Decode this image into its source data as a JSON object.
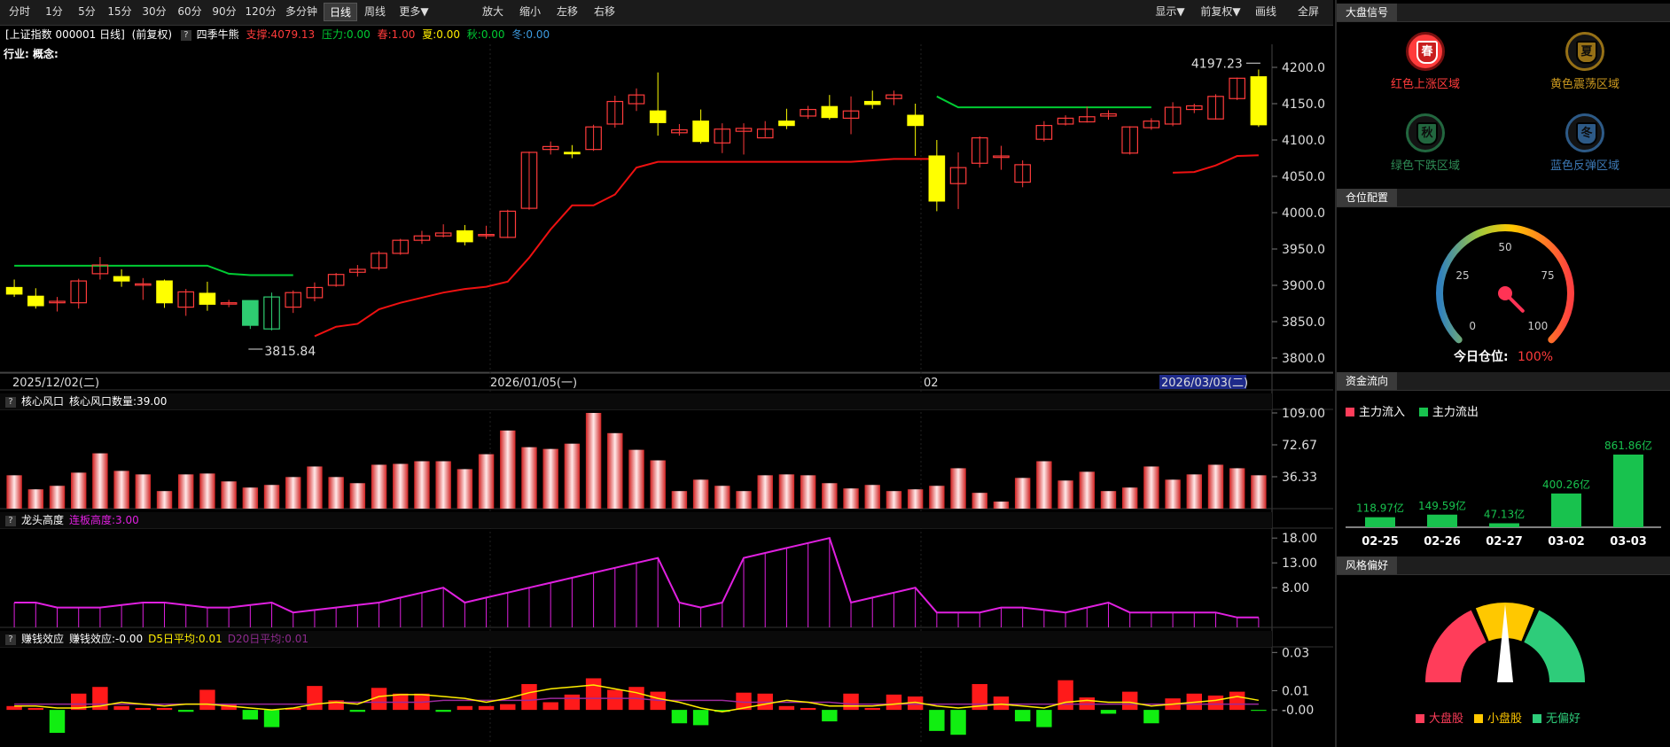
{
  "toolbar": {
    "periods": [
      "分时",
      "1分",
      "5分",
      "15分",
      "30分",
      "60分",
      "90分",
      "120分",
      "多分钟",
      "日线",
      "周线",
      "更多▼"
    ],
    "active": "日线",
    "zoom_in": "放大",
    "zoom_out": "缩小",
    "move_left": "左移",
    "move_right": "右移",
    "display": "显示▼",
    "adjust": "前复权▼",
    "draw": "画线",
    "fullscreen": "全屏"
  },
  "info": {
    "security": "[上证指数 000001 日线]",
    "adjust": "(前复权)",
    "indicator": "四季牛熊",
    "support": "支撑:4079.13",
    "pressure": "压力:0.00",
    "spring": "春:1.00",
    "summer": "夏:0.00",
    "autumn": "秋:0.00",
    "winter": "冬:0.00"
  },
  "industry": "行业: 概念:",
  "colors": {
    "up": "#ff3b3b",
    "down_fill": "#ffff00",
    "green": "#00cc33",
    "line_red": "#ee1111",
    "magenta": "#e020e0",
    "yellow": "#ffee00"
  },
  "price_axis": {
    "min": 3800,
    "max": 4200,
    "ticks": [
      "4200.0",
      "4150.0",
      "4100.0",
      "4050.0",
      "4000.0",
      "3950.0",
      "3900.0",
      "3850.0",
      "3800.0"
    ]
  },
  "date_axis": {
    "labels": [
      "2025/12/02(二)",
      "2026/01/05(一)",
      "02",
      "2026/03/03(二)"
    ]
  },
  "annotations": {
    "high": "4197.23",
    "low": "3815.84"
  },
  "candles": [
    [
      3897,
      3888,
      3908,
      3884
    ],
    [
      3885,
      3872,
      3896,
      3868
    ],
    [
      3876,
      3878,
      3884,
      3864
    ],
    [
      3876,
      3906,
      3909,
      3868
    ],
    [
      3916,
      3928,
      3939,
      3908
    ],
    [
      3912,
      3906,
      3922,
      3898
    ],
    [
      3902,
      3902,
      3910,
      3880
    ],
    [
      3906,
      3876,
      3908,
      3869
    ],
    [
      3870,
      3891,
      3895,
      3858
    ],
    [
      3889,
      3874,
      3905,
      3865
    ],
    [
      3876,
      3876,
      3880,
      3870
    ],
    [
      3879,
      3845,
      3879,
      3840
    ],
    [
      3840,
      3884,
      3890,
      3838
    ],
    [
      3870,
      3890,
      3893,
      3862
    ],
    [
      3883,
      3897,
      3904,
      3878
    ],
    [
      3900,
      3915,
      3917,
      3898
    ],
    [
      3918,
      3922,
      3928,
      3912
    ],
    [
      3924,
      3944,
      3947,
      3921
    ],
    [
      3944,
      3962,
      3964,
      3942
    ],
    [
      3962,
      3968,
      3975,
      3957
    ],
    [
      3968,
      3972,
      3984,
      3966
    ],
    [
      3975,
      3960,
      3983,
      3955
    ],
    [
      3970,
      3970,
      3982,
      3964
    ],
    [
      3966,
      4002,
      4004,
      3965
    ],
    [
      4006,
      4083,
      4084,
      4004
    ],
    [
      4087,
      4091,
      4098,
      4080
    ],
    [
      4083,
      4081,
      4093,
      4075
    ],
    [
      4087,
      4118,
      4121,
      4085
    ],
    [
      4122,
      4153,
      4161,
      4117
    ],
    [
      4150,
      4162,
      4171,
      4140
    ],
    [
      4140,
      4124,
      4193,
      4106
    ],
    [
      4110,
      4114,
      4122,
      4106
    ],
    [
      4126,
      4098,
      4142,
      4095
    ],
    [
      4096,
      4115,
      4123,
      4082
    ],
    [
      4112,
      4116,
      4123,
      4080
    ],
    [
      4103,
      4115,
      4126,
      4104
    ],
    [
      4126,
      4120,
      4143,
      4115
    ],
    [
      4133,
      4142,
      4147,
      4129
    ],
    [
      4146,
      4131,
      4162,
      4128
    ],
    [
      4130,
      4140,
      4160,
      4108
    ],
    [
      4153,
      4149,
      4168,
      4143
    ],
    [
      4157,
      4162,
      4168,
      4148
    ],
    [
      4134,
      4120,
      4150,
      4078
    ],
    [
      4078,
      4016,
      4100,
      4002
    ],
    [
      4040,
      4062,
      4083,
      4005
    ],
    [
      4068,
      4103,
      4105,
      4062
    ],
    [
      4076,
      4078,
      4092,
      4059
    ],
    [
      4042,
      4066,
      4072,
      4035
    ],
    [
      4101,
      4120,
      4126,
      4098
    ],
    [
      4122,
      4130,
      4134,
      4120
    ],
    [
      4125,
      4132,
      4146,
      4124
    ],
    [
      4133,
      4136,
      4141,
      4128
    ],
    [
      4082,
      4118,
      4119,
      4080
    ],
    [
      4117,
      4126,
      4130,
      4114
    ],
    [
      4122,
      4145,
      4152,
      4119
    ],
    [
      4142,
      4147,
      4150,
      4137
    ],
    [
      4129,
      4160,
      4163,
      4128
    ],
    [
      4157,
      4185,
      4186,
      4155
    ],
    [
      4187,
      4121,
      4197,
      4118
    ]
  ],
  "support_line": [
    null,
    null,
    null,
    null,
    null,
    null,
    null,
    null,
    null,
    null,
    null,
    null,
    null,
    null,
    3830,
    3843,
    3847,
    3867,
    3876,
    3883,
    3890,
    3895,
    3898,
    3905,
    3938,
    3977,
    4010,
    4010,
    4025,
    4062,
    4070,
    4070,
    4070,
    4070,
    4070,
    4070,
    4070,
    4070,
    4070,
    4070,
    4072,
    4074,
    4074,
    4074,
    null,
    null,
    null,
    null,
    null,
    null,
    null,
    null,
    null,
    null,
    4055,
    4056,
    4065,
    4078,
    4079
  ],
  "pressure_line": [
    3927,
    3927,
    3927,
    3927,
    3927,
    3927,
    3927,
    3927,
    3927,
    3927,
    3916,
    3914,
    3914,
    3914,
    null,
    null,
    null,
    null,
    null,
    null,
    null,
    null,
    null,
    null,
    null,
    null,
    null,
    null,
    null,
    null,
    null,
    null,
    null,
    null,
    null,
    null,
    null,
    null,
    null,
    null,
    null,
    null,
    null,
    4160,
    4145,
    4145,
    4145,
    4145,
    4145,
    4145,
    4145,
    4145,
    4145,
    4145,
    null,
    null,
    null,
    null,
    null
  ],
  "panel1": {
    "title": "核心风口",
    "value_label": "核心风口数量:39.00",
    "ticks": [
      "109.00",
      "72.67",
      "36.33"
    ],
    "max": 109,
    "values": [
      38,
      22,
      26,
      41,
      63,
      43,
      39,
      20,
      39,
      40,
      31,
      24,
      27,
      36,
      48,
      36,
      29,
      50,
      51,
      54,
      54,
      45,
      62,
      89,
      70,
      68,
      74,
      109,
      86,
      67,
      55,
      20,
      33,
      26,
      20,
      38,
      39,
      38,
      29,
      23,
      27,
      20,
      22,
      26,
      46,
      18,
      8,
      35,
      54,
      32,
      42,
      20,
      24,
      48,
      33,
      39,
      50,
      46,
      38
    ]
  },
  "panel2": {
    "title": "龙头高度",
    "value_label": "连板高度:3.00",
    "ticks": [
      "18.00",
      "13.00",
      "8.00"
    ],
    "max": 20,
    "values": [
      5,
      5,
      4,
      4,
      4,
      4.5,
      5,
      5,
      4.5,
      4,
      4,
      4.5,
      5,
      3,
      3.5,
      4,
      4.5,
      5,
      6,
      7,
      8,
      5,
      6,
      7,
      8,
      9,
      10,
      11,
      12,
      13,
      14,
      5,
      4,
      5,
      14,
      15,
      16,
      17,
      18,
      5,
      6,
      7,
      8,
      3,
      3,
      3,
      4,
      4,
      3.5,
      3,
      4,
      5,
      3,
      3,
      3,
      3,
      3,
      2,
      2
    ]
  },
  "panel3": {
    "title": "赚钱效应",
    "value_label": "赚钱效应:-0.00",
    "ma5": "D5日平均:0.01",
    "ma20": "D20日平均:0.01",
    "ticks": [
      "0.03",
      "0.01",
      "-0.00"
    ],
    "max": 0.032,
    "min": -0.018,
    "values": [
      0.002,
      0.001,
      -0.012,
      0.0085,
      0.012,
      0.002,
      0.001,
      0.001,
      -0.001,
      0.0105,
      0.003,
      -0.005,
      -0.009,
      0.001,
      0.0125,
      0.005,
      -0.001,
      0.0115,
      0.0085,
      0.0085,
      -0.001,
      0.002,
      0.002,
      0.003,
      0.0135,
      0.004,
      0.008,
      0.0165,
      0.0105,
      0.012,
      0.0095,
      -0.007,
      -0.008,
      -0.001,
      0.009,
      0.0085,
      0.002,
      0.001,
      -0.006,
      0.0085,
      0.001,
      0.008,
      0.007,
      -0.011,
      -0.013,
      0.0135,
      0.007,
      -0.006,
      -0.009,
      0.0155,
      0.0065,
      -0.002,
      0.0095,
      -0.007,
      0.006,
      0.0085,
      0.0075,
      0.0095,
      -0.0005
    ],
    "ma5_values": [
      0.002,
      0.002,
      0.001,
      0.001,
      0.002,
      0.004,
      0.003,
      0.002,
      0.003,
      0.003,
      0.002,
      0.001,
      0.0,
      0.001,
      0.003,
      0.004,
      0.003,
      0.007,
      0.008,
      0.008,
      0.007,
      0.006,
      0.004,
      0.006,
      0.009,
      0.011,
      0.012,
      0.013,
      0.011,
      0.009,
      0.006,
      0.004,
      0.001,
      -0.001,
      0.001,
      0.003,
      0.005,
      0.004,
      0.002,
      0.002,
      0.002,
      0.003,
      0.004,
      0.002,
      0.001,
      0.002,
      0.003,
      0.002,
      0.001,
      0.004,
      0.005,
      0.004,
      0.004,
      0.002,
      0.003,
      0.004,
      0.005,
      0.007,
      0.005
    ],
    "ma20_values": [
      0.003,
      0.003,
      0.003,
      0.003,
      0.003,
      0.003,
      0.003,
      0.003,
      0.003,
      0.003,
      0.003,
      0.003,
      0.003,
      0.003,
      0.003,
      0.004,
      0.004,
      0.004,
      0.004,
      0.004,
      0.005,
      0.005,
      0.005,
      0.005,
      0.005,
      0.006,
      0.006,
      0.006,
      0.006,
      0.006,
      0.005,
      0.005,
      0.005,
      0.005,
      0.004,
      0.004,
      0.004,
      0.004,
      0.004,
      0.003,
      0.003,
      0.003,
      0.003,
      0.003,
      0.003,
      0.003,
      0.003,
      0.003,
      0.003,
      0.003,
      0.003,
      0.003,
      0.003,
      0.003,
      0.003,
      0.003,
      0.003,
      0.003,
      0.003
    ]
  },
  "right": {
    "market_signal": {
      "title": "大盘信号",
      "items": [
        {
          "badge": "春",
          "label": "红色上涨区域",
          "color": "#ff3b3b",
          "active": true
        },
        {
          "badge": "夏",
          "label": "黄色震荡区域",
          "color": "#c8961e",
          "active": false
        },
        {
          "badge": "秋",
          "label": "绿色下跌区域",
          "color": "#2e8a55",
          "active": false
        },
        {
          "badge": "冬",
          "label": "蓝色反弹区域",
          "color": "#3c78b4",
          "active": false
        }
      ]
    },
    "position": {
      "title": "仓位配置",
      "ticks": [
        "0",
        "25",
        "50",
        "75",
        "100"
      ],
      "label": "今日仓位:",
      "value": "100%",
      "value_num": 100
    },
    "fund_flow": {
      "title": "资金流向",
      "legend_in": "主力流入",
      "legend_out": "主力流出",
      "dates": [
        "02-25",
        "02-26",
        "02-27",
        "03-02",
        "03-03"
      ],
      "labels": [
        "118.97亿",
        "149.59亿",
        "47.13亿",
        "400.26亿",
        "861.86亿"
      ],
      "values": [
        118.97,
        149.59,
        47.13,
        400.26,
        861.86
      ]
    },
    "style": {
      "title": "风格偏好",
      "legend": [
        "大盘股",
        "小盘股",
        "无偏好"
      ],
      "colors": [
        "#ff3d5a",
        "#ffc800",
        "#2ecc7a"
      ]
    }
  }
}
